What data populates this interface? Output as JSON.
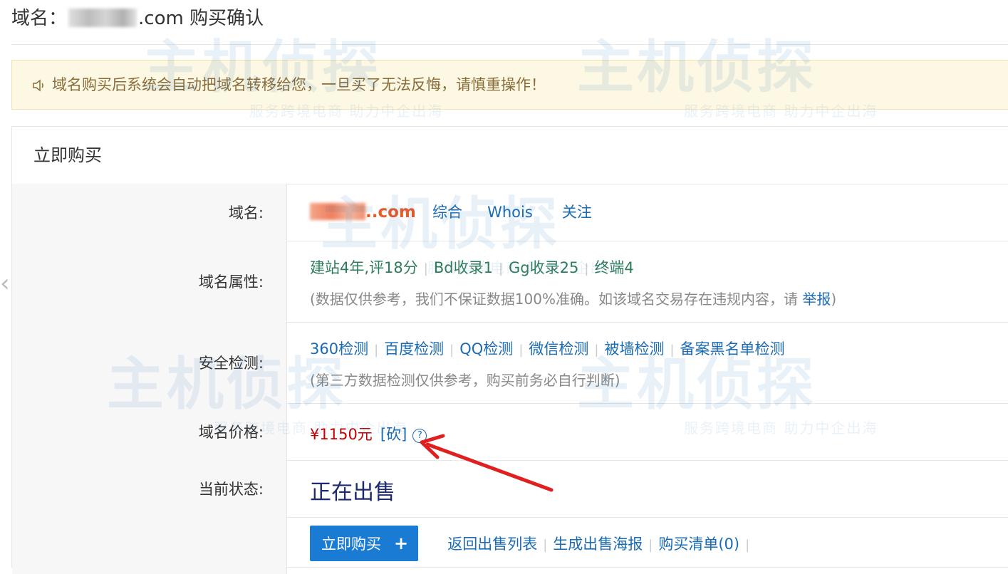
{
  "header": {
    "title_prefix": "域名：",
    "title_suffix": ".com 购买确认"
  },
  "notice": {
    "icon": "speaker-icon",
    "text": "域名购买后系统会自动把域名转移给您，一旦买了无法反悔，请慎重操作！"
  },
  "panel": {
    "title": "立即购买",
    "rows": {
      "domain": {
        "label": "域名:",
        "domain_suffix": "..com",
        "links": [
          "综合",
          "Whois",
          "关注"
        ]
      },
      "attributes": {
        "label": "域名属性:",
        "items": [
          "建站4年,评18分",
          "Bd收录1",
          "Gg收录25",
          "终端4"
        ],
        "note_prefix": "(数据仅供参考，我们不保证数据100%准确。如该域名交易存在违规内容，请 ",
        "report_link": "举报",
        "note_suffix": ")"
      },
      "security": {
        "label": "安全检测:",
        "links": [
          "360检测",
          "百度检测",
          "QQ检测",
          "微信检测",
          "被墙检测",
          "备案黑名单检测"
        ],
        "note": "(第三方数据检测仅供参考，购买前务必自行判断)"
      },
      "price": {
        "label": "域名价格:",
        "value": "¥1150元",
        "bargain": "[砍]",
        "help": "?"
      },
      "status": {
        "label": "当前状态:",
        "value": "正在出售"
      },
      "actions": {
        "buy_label": "立即购买",
        "buy_plus": "+",
        "links": [
          "返回出售列表",
          "生成出售海报",
          "购买清单(0)"
        ]
      }
    }
  },
  "watermark": {
    "title": "主机侦探",
    "slogan": "服务跨境电商 助力中企出海"
  },
  "colors": {
    "link": "#1a6bb5",
    "price": "#c40000",
    "domain": "#ee5a24",
    "notice_bg": "#fcf8e3",
    "button": "#1a7bd4",
    "arrow": "#e02020"
  }
}
